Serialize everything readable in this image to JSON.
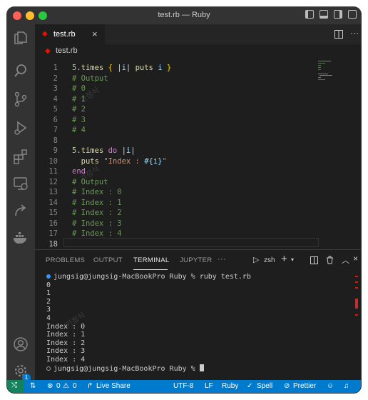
{
  "window": {
    "title": "test.rb — Ruby"
  },
  "tab": {
    "label": "test.rb",
    "close": "×"
  },
  "breadcrumb": {
    "file": "test.rb"
  },
  "editor": {
    "lines": [
      {
        "n": "1",
        "tokens": [
          [
            "num",
            "5"
          ],
          [
            "plain",
            "."
          ],
          [
            "fn",
            "times"
          ],
          [
            "plain",
            " "
          ],
          [
            "br",
            "{"
          ],
          [
            "plain",
            " |"
          ],
          [
            "var",
            "i"
          ],
          [
            "plain",
            "| "
          ],
          [
            "fn",
            "puts"
          ],
          [
            "plain",
            " "
          ],
          [
            "var",
            "i"
          ],
          [
            "plain",
            " "
          ],
          [
            "br",
            "}"
          ]
        ]
      },
      {
        "n": "2",
        "tokens": [
          [
            "cm",
            "# Output"
          ]
        ]
      },
      {
        "n": "3",
        "tokens": [
          [
            "cm",
            "# 0"
          ]
        ]
      },
      {
        "n": "4",
        "tokens": [
          [
            "cm",
            "# 1"
          ]
        ]
      },
      {
        "n": "5",
        "tokens": [
          [
            "cm",
            "# 2"
          ]
        ]
      },
      {
        "n": "6",
        "tokens": [
          [
            "cm",
            "# 3"
          ]
        ]
      },
      {
        "n": "7",
        "tokens": [
          [
            "cm",
            "# 4"
          ]
        ]
      },
      {
        "n": "8",
        "tokens": []
      },
      {
        "n": "9",
        "tokens": [
          [
            "num",
            "5"
          ],
          [
            "plain",
            "."
          ],
          [
            "fn",
            "times"
          ],
          [
            "plain",
            " "
          ],
          [
            "kw",
            "do"
          ],
          [
            "plain",
            " |"
          ],
          [
            "var",
            "i"
          ],
          [
            "plain",
            "|"
          ]
        ]
      },
      {
        "n": "10",
        "tokens": [
          [
            "plain",
            "  "
          ],
          [
            "fn",
            "puts"
          ],
          [
            "plain",
            " "
          ],
          [
            "str",
            "\"Index : "
          ],
          [
            "var",
            "#{i}"
          ],
          [
            "str",
            "\""
          ]
        ]
      },
      {
        "n": "11",
        "tokens": [
          [
            "kw",
            "end"
          ]
        ]
      },
      {
        "n": "12",
        "tokens": [
          [
            "cm",
            "# Output"
          ]
        ]
      },
      {
        "n": "13",
        "tokens": [
          [
            "cm",
            "# Index : 0"
          ]
        ]
      },
      {
        "n": "14",
        "tokens": [
          [
            "cm",
            "# Index : 1"
          ]
        ]
      },
      {
        "n": "15",
        "tokens": [
          [
            "cm",
            "# Index : 2"
          ]
        ]
      },
      {
        "n": "16",
        "tokens": [
          [
            "cm",
            "# Index : 3"
          ]
        ]
      },
      {
        "n": "17",
        "tokens": [
          [
            "cm",
            "# Index : 4"
          ]
        ]
      },
      {
        "n": "18",
        "tokens": []
      }
    ]
  },
  "panel": {
    "tabs": [
      "PROBLEMS",
      "OUTPUT",
      "TERMINAL",
      "JUPYTER"
    ],
    "more": "···",
    "shell": "zsh",
    "terminal_lines": [
      "jungsig@jungsig-MacBookPro Ruby % ruby test.rb",
      "0",
      "1",
      "2",
      "3",
      "4",
      "Index : 0",
      "Index : 1",
      "Index : 2",
      "Index : 3",
      "Index : 4"
    ],
    "prompt": "jungsig@jungsig-MacBookPro Ruby % "
  },
  "status": {
    "errors": "0",
    "warnings": "0",
    "live_share": "Live Share",
    "encoding": "UTF-8",
    "eol": "LF",
    "language": "Ruby",
    "spell": "Spell",
    "prettier": "Prettier"
  },
  "activity": {
    "badge": "1"
  },
  "colors": {
    "statusbar": "#007acc",
    "accent_red": "#e51400",
    "terminal_dot": "#3794ff"
  },
  "watermark": "기정식"
}
